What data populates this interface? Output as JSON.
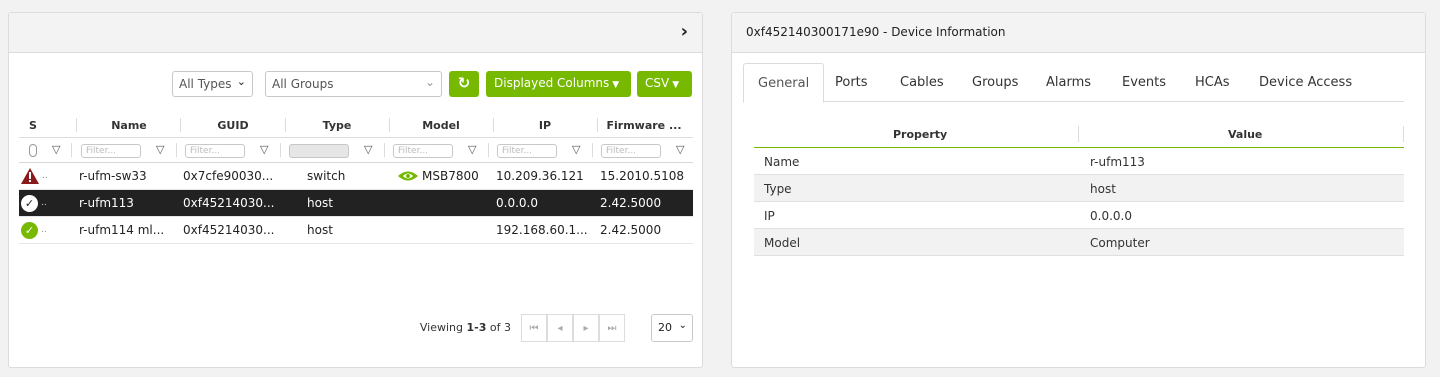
{
  "devices_panel": {
    "collapse_icon": "chevron-right-icon",
    "toolbar": {
      "types_select": "All Types",
      "groups_select": "All Groups",
      "refresh_icon": "refresh-icon",
      "columns_button": "Displayed Columns",
      "csv_button": "CSV"
    },
    "columns": [
      "S",
      "Name",
      "GUID",
      "Type",
      "Model",
      "IP",
      "Firmware ..."
    ],
    "filter_placeholder": "Filter...",
    "rows": [
      {
        "status": "warning",
        "name": "r-ufm-sw33",
        "guid": "0x7cfe90030...",
        "type": "switch",
        "model": "MSB7800",
        "model_icon": "nvidia-logo-icon",
        "ip": "10.209.36.121",
        "firmware": "15.2010.5108",
        "selected": false
      },
      {
        "status": "ok",
        "name": "r-ufm113",
        "guid": "0xf45214030...",
        "type": "host",
        "model": "",
        "ip": "0.0.0.0",
        "firmware": "2.42.5000",
        "selected": true
      },
      {
        "status": "ok",
        "name": "r-ufm114 ml...",
        "guid": "0xf45214030...",
        "type": "host",
        "model": "",
        "ip": "192.168.60.1...",
        "firmware": "2.42.5000",
        "selected": false
      }
    ],
    "pager": {
      "viewing_prefix": "Viewing ",
      "viewing_range": "1-3",
      "viewing_suffix": " of 3",
      "page_size": "20"
    }
  },
  "device_info_panel": {
    "title": "0xf452140300171e90 - Device Information",
    "tabs": [
      "General",
      "Ports",
      "Cables",
      "Groups",
      "Alarms",
      "Events",
      "HCAs",
      "Device Access"
    ],
    "active_tab": "General",
    "table_headers": {
      "property": "Property",
      "value": "Value"
    },
    "properties": [
      {
        "property": "Name",
        "value": "r-ufm113"
      },
      {
        "property": "Type",
        "value": "host"
      },
      {
        "property": "IP",
        "value": "0.0.0.0"
      },
      {
        "property": "Model",
        "value": "Computer"
      }
    ]
  },
  "colors": {
    "accent_green": "#76b900",
    "selected_row": "#222222",
    "warning_red": "#8b1a1a"
  }
}
